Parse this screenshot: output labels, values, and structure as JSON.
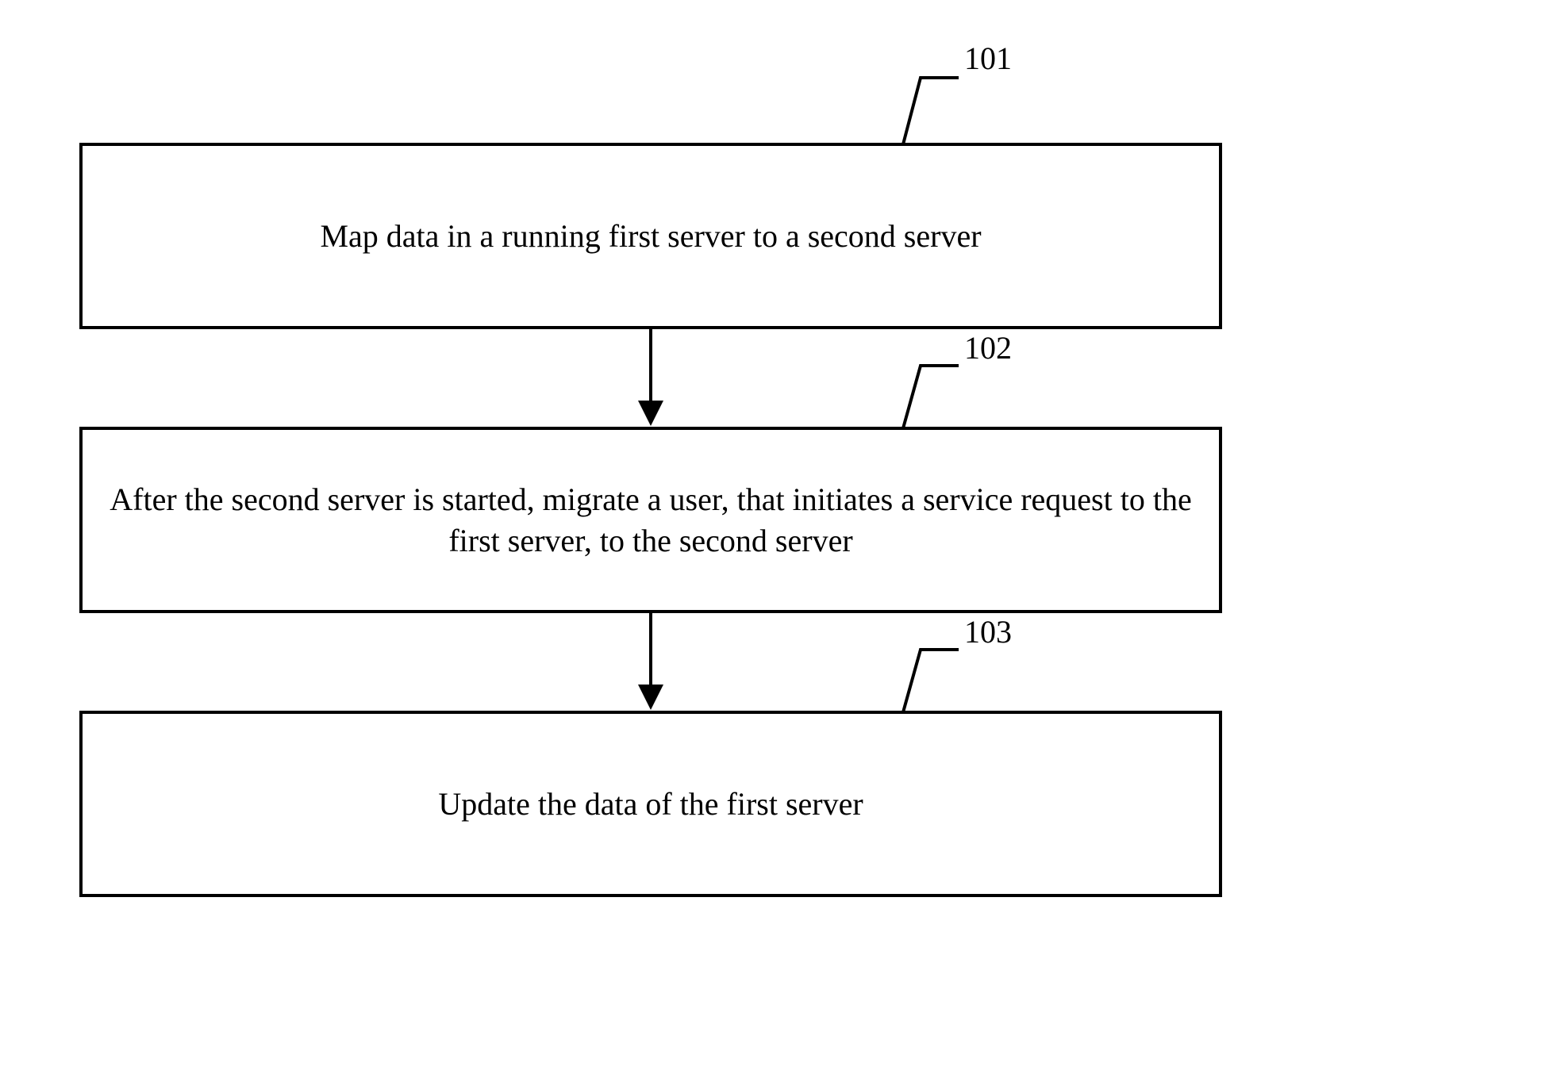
{
  "steps": [
    {
      "label": "101",
      "text": "Map data in a running first server to a second server"
    },
    {
      "label": "102",
      "text": "After the second server is started, migrate a user, that initiates a service request to the first server, to the second server"
    },
    {
      "label": "103",
      "text": "Update the data of the first server"
    }
  ]
}
